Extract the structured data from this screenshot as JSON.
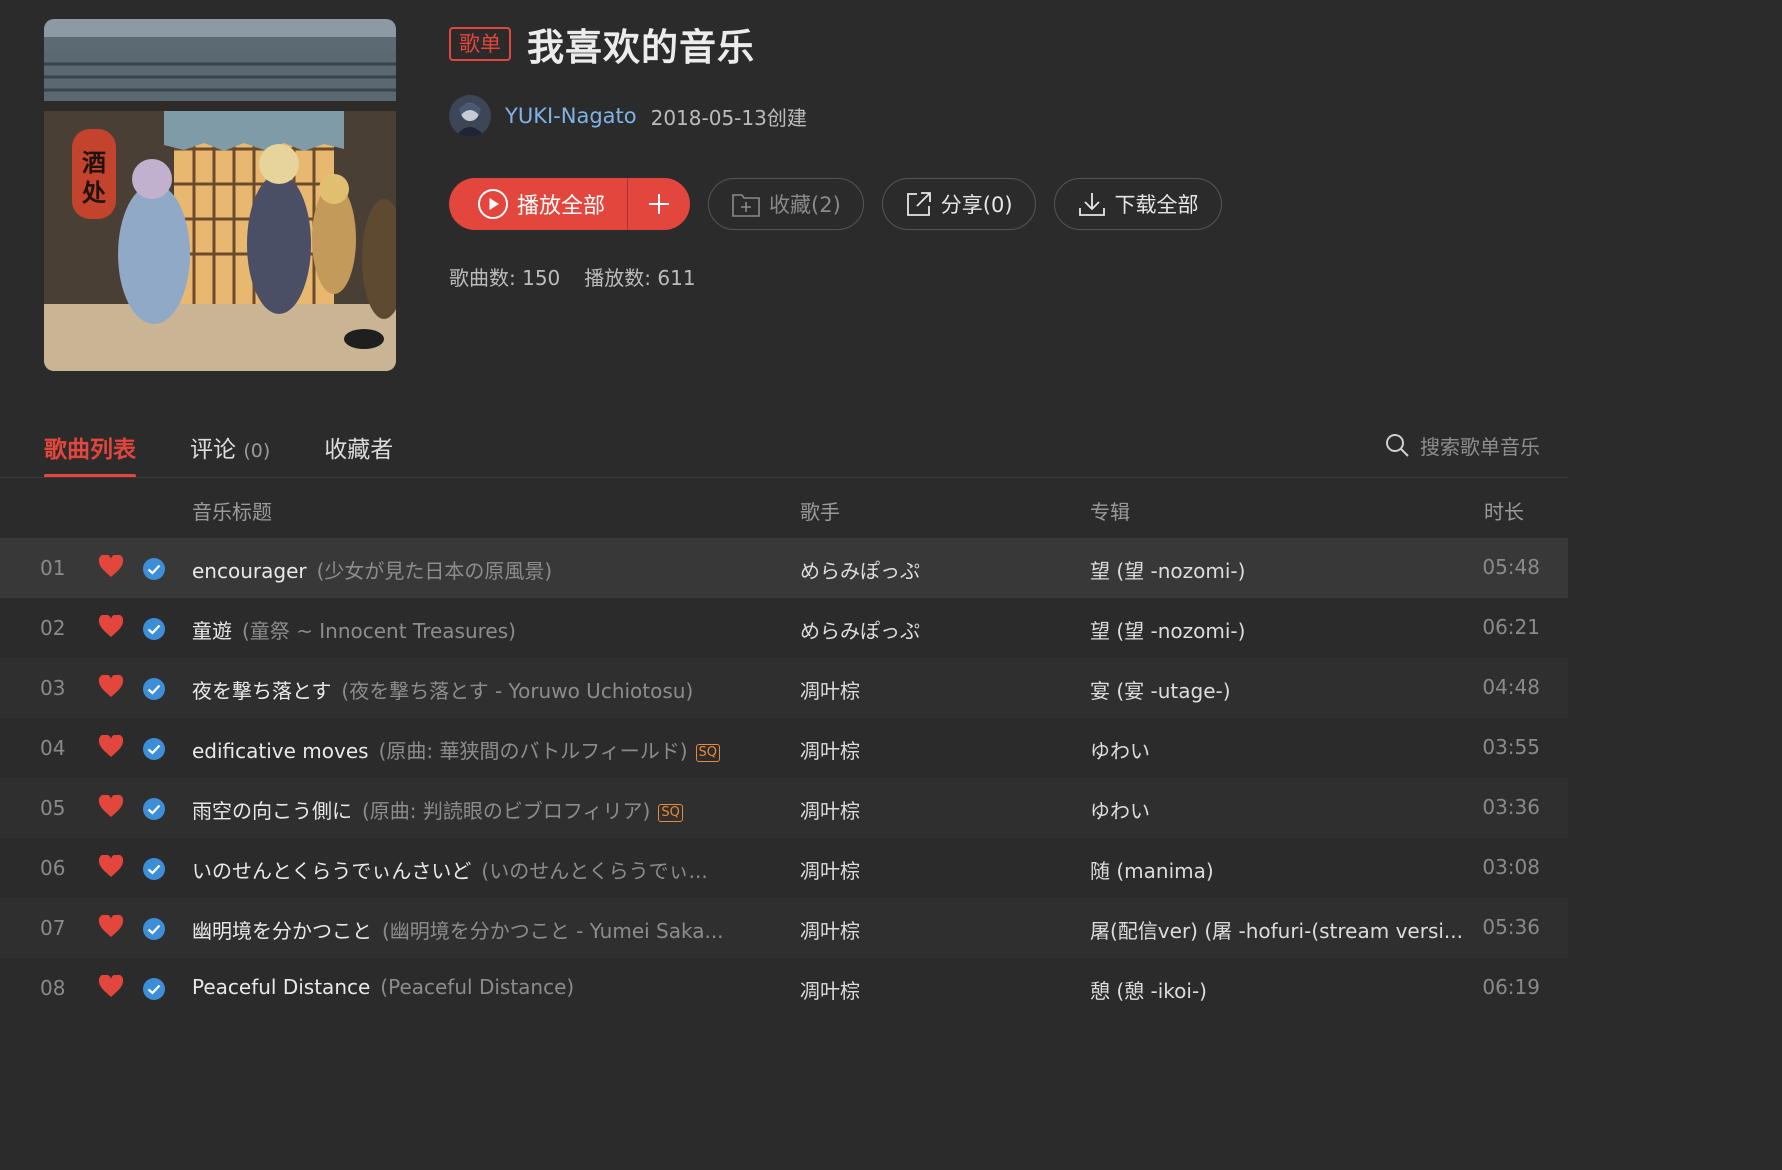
{
  "playlist": {
    "tag": "歌单",
    "title": "我喜欢的音乐",
    "creator": "YUKI-Nagato",
    "created": "2018-05-13创建",
    "cover_sign": "酒处"
  },
  "actions": {
    "play_all": "播放全部",
    "favorite": "收藏(2)",
    "share": "分享(0)",
    "download_all": "下载全部"
  },
  "stats": {
    "songs_label": "歌曲数: 150",
    "plays_label": "播放数: 611"
  },
  "tabs": {
    "songs": "歌曲列表",
    "comments": "评论",
    "comments_count": "(0)",
    "subscribers": "收藏者"
  },
  "search": {
    "placeholder": "搜索歌单音乐"
  },
  "columns": {
    "title": "音乐标题",
    "artist": "歌手",
    "album": "专辑",
    "duration": "时长"
  },
  "songs": [
    {
      "idx": "01",
      "title": "encourager",
      "sub": "(少女が見た日本の原風景)",
      "sq": "",
      "artist": "めらみぽっぷ",
      "album": "望 (望 -nozomi-)",
      "duration": "05:48"
    },
    {
      "idx": "02",
      "title": "童遊",
      "sub": "(童祭 ~ Innocent Treasures)",
      "sq": "",
      "artist": "めらみぽっぷ",
      "album": "望 (望 -nozomi-)",
      "duration": "06:21"
    },
    {
      "idx": "03",
      "title": "夜を撃ち落とす",
      "sub": "(夜を撃ち落とす - Yoruwo Uchiotosu)",
      "sq": "",
      "artist": "凋叶棕",
      "album": "宴 (宴 -utage-)",
      "duration": "04:48"
    },
    {
      "idx": "04",
      "title": "edificative moves",
      "sub": "(原曲: 華狭間のバトルフィールド)",
      "sq": "SQ",
      "artist": "凋叶棕",
      "album": "ゆわい",
      "duration": "03:55"
    },
    {
      "idx": "05",
      "title": "雨空の向こう側に",
      "sub": "(原曲: 判読眼のビブロフィリア)",
      "sq": "SQ",
      "artist": "凋叶棕",
      "album": "ゆわい",
      "duration": "03:36"
    },
    {
      "idx": "06",
      "title": "いのせんとくらうでぃんさいど",
      "sub": "(いのせんとくらうでぃ...",
      "sq": "",
      "artist": "凋叶棕",
      "album": "随 (manima)",
      "duration": "03:08"
    },
    {
      "idx": "07",
      "title": "幽明境を分かつこと",
      "sub": "(幽明境を分かつこと - Yumei Saka...",
      "sq": "",
      "artist": "凋叶棕",
      "album": "屠(配信ver) (屠 -hofuri-(stream versi...",
      "duration": "05:36"
    },
    {
      "idx": "08",
      "title": "Peaceful Distance",
      "sub": "(Peaceful Distance)",
      "sq": "",
      "artist": "凋叶棕",
      "album": "憩 (憩 -ikoi-)",
      "duration": "06:19"
    }
  ],
  "colors": {
    "accent": "#e2463c",
    "link": "#7fb3e8",
    "heart": "#e2463c",
    "check": "#3d8ed8",
    "sq": "#e88a3a"
  },
  "icons": [
    "play-circle-icon",
    "plus-icon",
    "folder-plus-icon",
    "share-icon",
    "download-icon",
    "search-icon",
    "heart-icon",
    "check-circle-icon"
  ]
}
